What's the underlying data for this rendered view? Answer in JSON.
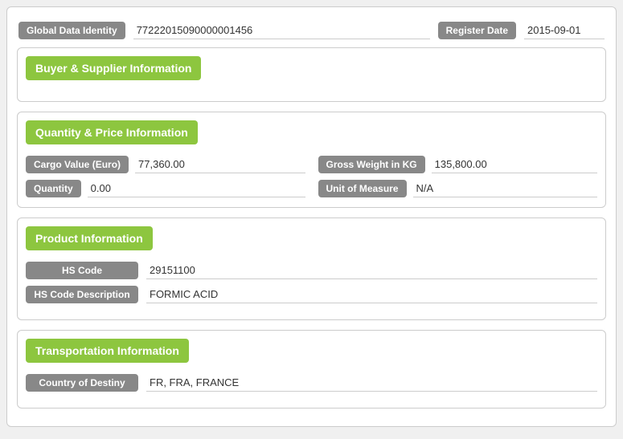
{
  "global": {
    "label_gdi": "Global Data Identity",
    "value_gdi": "77222015090000001456",
    "label_date": "Register Date",
    "value_date": "2015-09-01"
  },
  "sections": {
    "buyer_supplier": {
      "title": "Buyer & Supplier Information"
    },
    "quantity_price": {
      "title": "Quantity & Price Information",
      "fields": [
        {
          "label": "Cargo Value (Euro)",
          "value": "77,360.00"
        },
        {
          "label": "Gross Weight in KG",
          "value": "135,800.00"
        },
        {
          "label": "Quantity",
          "value": "0.00"
        },
        {
          "label": "Unit of Measure",
          "value": "N/A"
        }
      ]
    },
    "product": {
      "title": "Product Information",
      "fields": [
        {
          "label": "HS Code",
          "value": "29151100"
        },
        {
          "label": "HS Code Description",
          "value": "FORMIC ACID"
        }
      ]
    },
    "transportation": {
      "title": "Transportation Information",
      "fields": [
        {
          "label": "Country of Destiny",
          "value": "FR, FRA, FRANCE"
        }
      ]
    }
  }
}
